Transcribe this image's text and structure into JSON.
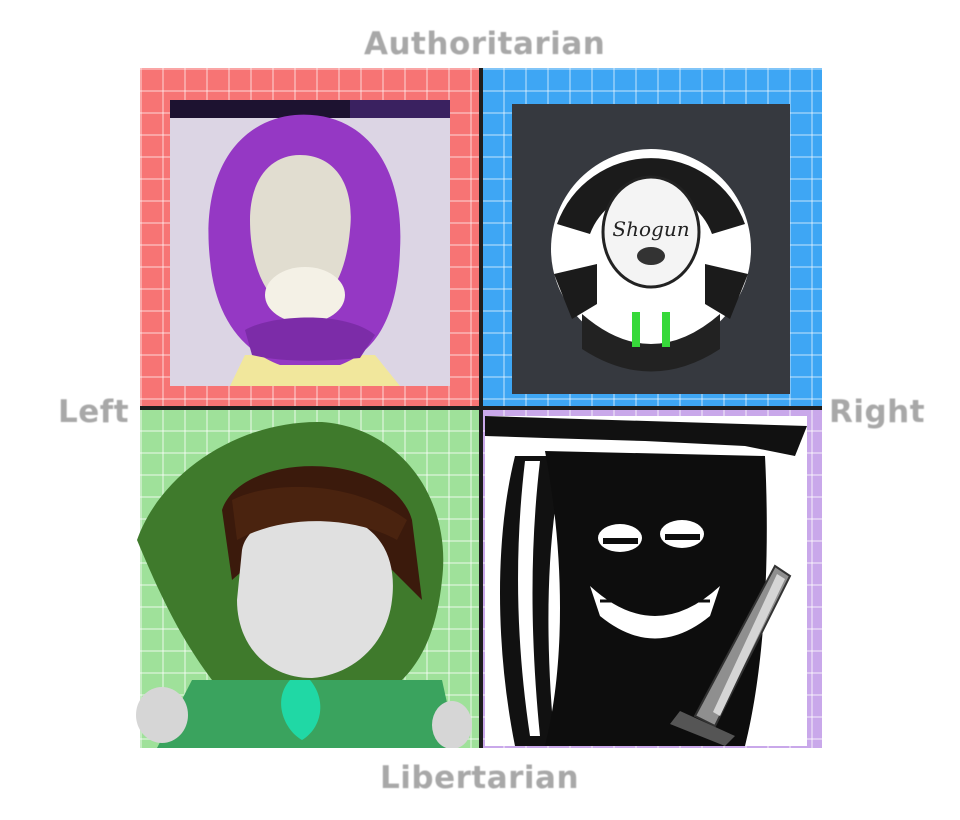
{
  "axes": {
    "top": "Authoritarian",
    "bottom": "Libertarian",
    "left": "Left",
    "right": "Right"
  },
  "quadrants": {
    "auth_left": {
      "color": "#f77474",
      "avatar": "purple-hooded-character"
    },
    "auth_right": {
      "color": "#3ea6f4",
      "avatar": "shogun-circle-avatar"
    },
    "lib_left": {
      "color": "#9fe19a",
      "avatar": "green-hooded-character"
    },
    "lib_right": {
      "color": "#c9a8ea",
      "avatar": "black-hat-swordsman"
    }
  },
  "avatars": {
    "auth_right_caption": "Shogun"
  }
}
